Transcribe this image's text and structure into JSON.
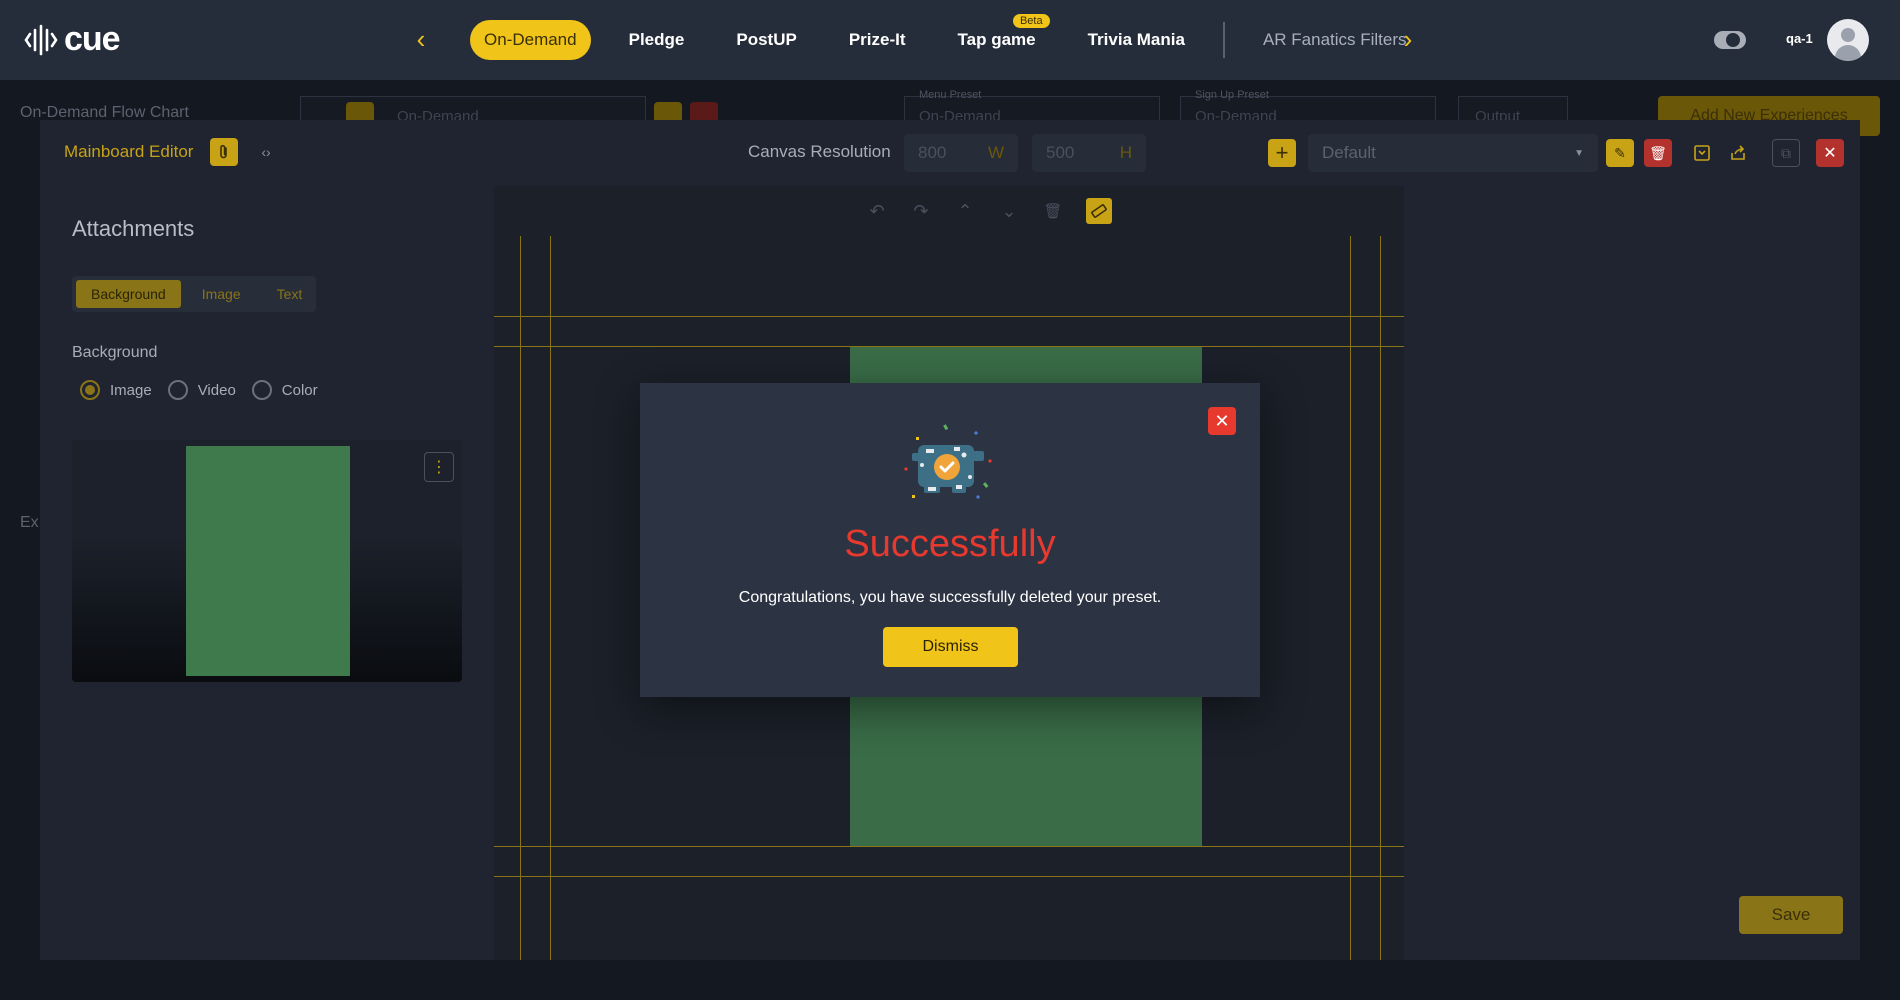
{
  "nav": {
    "brand": "cue",
    "tabs": [
      {
        "label": "On-Demand"
      },
      {
        "label": "Pledge"
      },
      {
        "label": "PostUP"
      },
      {
        "label": "Prize-It"
      },
      {
        "label": "Tap game",
        "badge": "Beta"
      },
      {
        "label": "Trivia Mania"
      },
      {
        "label": "AR Fanatics Filters"
      }
    ],
    "user": "qa-1"
  },
  "background_page": {
    "title": "On-Demand Flow Chart",
    "flow_select": "On-Demand",
    "menu_preset_label": "Menu Preset",
    "menu_preset_value": "On-Demand",
    "signup_preset_label": "Sign Up Preset",
    "signup_preset_value": "On-Demand",
    "output_label": "Output",
    "add_button": "Add New Experiences",
    "ex_label": "Ex"
  },
  "editor": {
    "title": "Mainboard Editor",
    "canvas_resolution_label": "Canvas Resolution",
    "width_value": "800",
    "width_unit": "W",
    "height_value": "500",
    "height_unit": "H",
    "preset_value": "Default",
    "attachments_title": "Attachments",
    "attachment_tabs": [
      "Background",
      "Image",
      "Text"
    ],
    "background_heading": "Background",
    "background_options": [
      "Image",
      "Video",
      "Color"
    ],
    "selected_background_option": "Image",
    "save_label": "Save"
  },
  "modal": {
    "title": "Successfully",
    "message": "Congratulations, you have successfully deleted your preset.",
    "dismiss_label": "Dismiss"
  },
  "colors": {
    "accent": "#f0c419",
    "danger": "#e8392f",
    "nav_bg": "#262d3a",
    "canvas_green": "#3e7a4c"
  }
}
